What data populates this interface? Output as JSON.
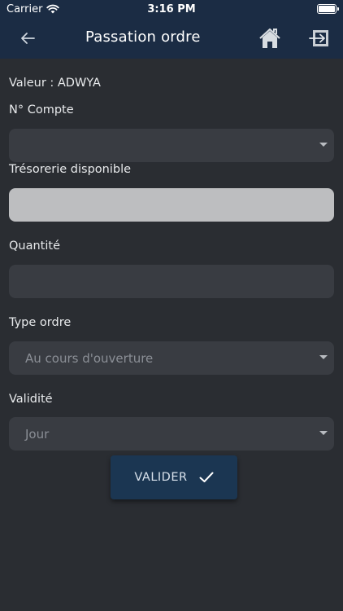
{
  "status_bar": {
    "carrier": "Carrier",
    "time": "3:16 PM",
    "icons": [
      "wifi-icon",
      "battery-icon"
    ]
  },
  "nav": {
    "title": "Passation ordre",
    "icons": [
      "arrow-left-icon",
      "home-icon",
      "logout-icon"
    ]
  },
  "form": {
    "valeur_label": "Valeur : ADWYA",
    "compte_label": "N° Compte",
    "compte_value": "",
    "tresorerie_label": "Trésorerie disponible",
    "tresorerie_value": "",
    "quantite_label": "Quantité",
    "quantite_value": "",
    "type_ordre_label": "Type ordre",
    "type_ordre_value": "Au cours d'ouverture",
    "validite_label": "Validité",
    "validite_value": "Jour"
  },
  "actions": {
    "validate_label": "VALIDER"
  },
  "colors": {
    "background": "#2a2d32",
    "header": "#1b2c44",
    "field": "#393c42",
    "disabled_field": "#bdbec0",
    "button": "#1b3652"
  }
}
